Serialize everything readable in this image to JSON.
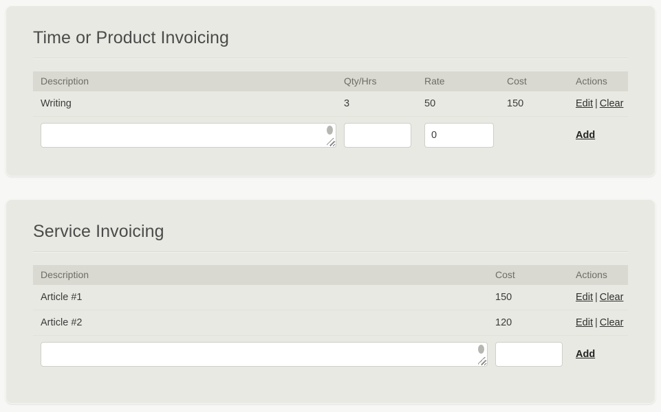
{
  "theme": {
    "page_background": "#f7f7f5",
    "card_background": "#e9e9e3",
    "table_header_background": "#d9d9d1",
    "title_color": "#4b4b4b",
    "text_color": "#3a3a3a",
    "input_background": "#ffffff",
    "input_border": "#cfcfc9"
  },
  "cards": {
    "time_product": {
      "title": "Time or Product Invoicing",
      "columns": [
        "Description",
        "Qty/Hrs",
        "Rate",
        "Cost",
        "Actions"
      ],
      "rows": [
        {
          "description": "Writing",
          "qty_hrs": "3",
          "rate": "50",
          "cost": "150",
          "edit_label": "Edit",
          "separator": "|",
          "clear_label": "Clear"
        }
      ],
      "form": {
        "description_value": "",
        "description_placeholder": "",
        "qty_value": "",
        "qty_placeholder": "",
        "rate_value": "0",
        "rate_placeholder": "",
        "cost_value": "",
        "add_label": "Add"
      }
    },
    "service": {
      "title": "Service Invoicing",
      "columns": [
        "Description",
        "Cost",
        "Actions"
      ],
      "rows": [
        {
          "description": "Article #1",
          "cost": "150",
          "edit_label": "Edit",
          "separator": "|",
          "clear_label": "Clear"
        },
        {
          "description": "Article #2",
          "cost": "120",
          "edit_label": "Edit",
          "separator": "|",
          "clear_label": "Clear"
        }
      ],
      "form": {
        "description_value": "",
        "description_placeholder": "",
        "cost_value": "",
        "cost_placeholder": "",
        "add_label": "Add"
      }
    }
  }
}
